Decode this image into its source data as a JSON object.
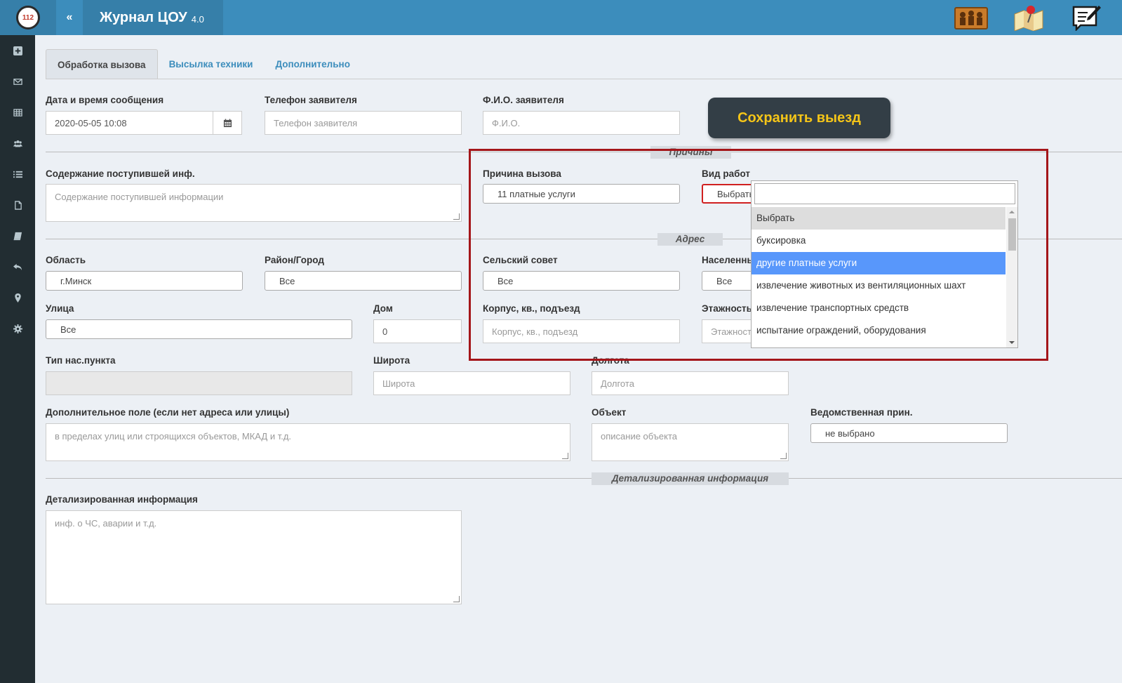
{
  "header": {
    "title": "Журнал ЦОУ",
    "version": "4.0",
    "logo_text": "112",
    "collapse_label": "«"
  },
  "tabs": [
    {
      "label": "Обработка вызова"
    },
    {
      "label": "Высылка техники"
    },
    {
      "label": "Дополнительно"
    }
  ],
  "form": {
    "datetime_label": "Дата и время сообщения",
    "datetime_value": "2020-05-05 10:08",
    "phone_label": "Телефон заявителя",
    "phone_placeholder": "Телефон заявителя",
    "fio_label": "Ф.И.О. заявителя",
    "fio_placeholder": "Ф.И.О.",
    "save_label": "Сохранить выезд",
    "section_reasons": "Причины",
    "content_label": "Содержание поступившей инф.",
    "content_placeholder": "Содержание поступившей информации",
    "reason_label": "Причина вызова",
    "reason_value": "11 платные услуги",
    "worktype_label": "Вид работ",
    "worktype_value": "Выбрать",
    "section_address": "Адрес",
    "region_label": "Область",
    "region_value": "г.Минск",
    "district_label": "Район/Город",
    "district_value": "Все",
    "council_label": "Сельский совет",
    "council_value": "Все",
    "settlement_label": "Населенный пункт",
    "settlement_value": "Все",
    "street_label": "Улица",
    "street_value": "Все",
    "house_label": "Дом",
    "house_value": "0",
    "building_label": "Корпус, кв., подъезд",
    "building_placeholder": "Корпус, кв., подъезд",
    "floors_label": "Этажность",
    "floors_placeholder": "Этажность",
    "settlement_type_label": "Тип нас.пункта",
    "lat_label": "Широта",
    "lat_placeholder": "Широта",
    "lon_label": "Долгота",
    "lon_placeholder": "Долгота",
    "extra_label": "Дополнительное поле (если нет адреса или улицы)",
    "extra_placeholder": "в пределах улиц или строящихся объектов, МКАД и т.д.",
    "object_label": "Объект",
    "object_placeholder": "описание объекта",
    "dept_label": "Ведомственная прин.",
    "dept_value": "не выбрано",
    "section_details": "Детализированная информация",
    "details_label": "Детализированная информация",
    "details_placeholder": "инф. о ЧС, аварии и т.д."
  },
  "dropdown": {
    "items": [
      "Выбрать",
      "буксировка",
      "другие платные услуги",
      "извлечение животных из вентиляционных шахт",
      "извлечение транспортных средств",
      "испытание ограждений, оборудования"
    ],
    "highlighted": "другие платные услуги"
  },
  "colors": {
    "topbar": "#3c8dbc",
    "sidebar": "#222d32",
    "highlight": "#5897fb",
    "save_text": "#f5c518",
    "annotation_box": "#a4161a"
  },
  "icons": [
    "plus-square-icon",
    "envelope-icon",
    "table-icon",
    "users-icon",
    "list-icon",
    "file-icon",
    "book-icon",
    "reply-all-icon",
    "map-marker-icon",
    "gear-icon"
  ]
}
